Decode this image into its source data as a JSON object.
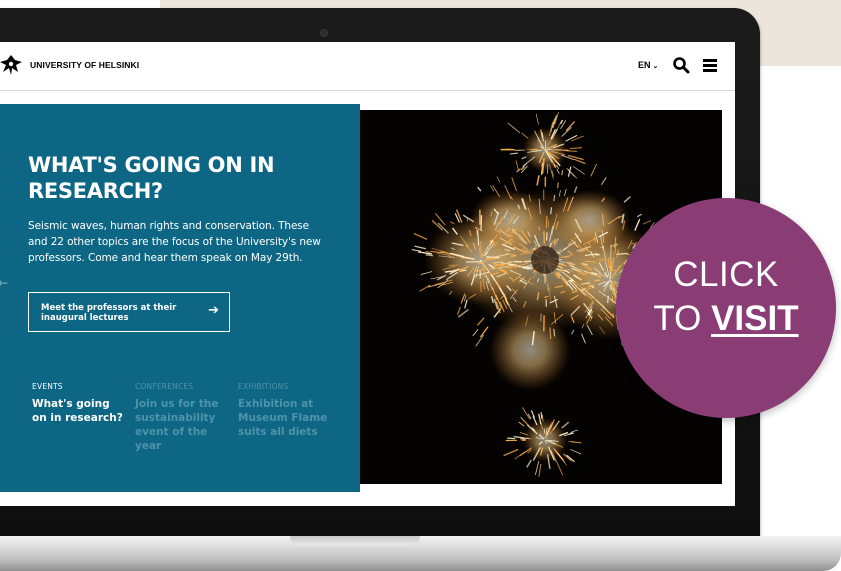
{
  "site": {
    "brand": "UNIVERSITY OF HELSINKI",
    "language": "EN",
    "icons": {
      "logo": "university-logo-icon",
      "search": "search-icon",
      "menu": "hamburger-menu-icon",
      "language_chevron": "chevron-down-icon",
      "cta_arrow": "arrow-right-icon",
      "carousel_prev": "arrow-left-icon"
    }
  },
  "hero": {
    "title": "WHAT'S GOING ON IN RESEARCH?",
    "description": "Seismic waves, human rights and conservation. These and 22 other topics are the focus of the University's new professors. Come and hear them speak on May 29th.",
    "cta_label": "Meet the professors at their inaugural lectures",
    "background_color": "#0c6684"
  },
  "tabs": [
    {
      "category": "EVENTS",
      "text": "What's going on in research?",
      "active": true
    },
    {
      "category": "CONFERENCES",
      "text": "Join us for the sustainability event of the year",
      "active": false
    },
    {
      "category": "EXHIBITIONS",
      "text": "Exhibition at Museum Flame suits all diets",
      "active": false
    }
  ],
  "badge": {
    "line1": "CLICK",
    "line2_prefix": "TO ",
    "line2_strong": "VISIT",
    "color": "#8a3d74"
  }
}
